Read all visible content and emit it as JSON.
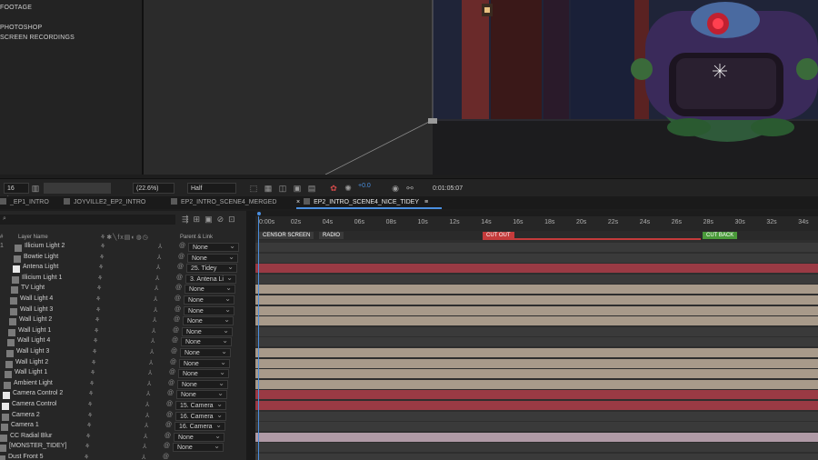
{
  "project": {
    "items": [
      "FOOTAGE",
      "PHOTOSHOP",
      "SCREEN RECORDINGS"
    ]
  },
  "viewer": {
    "bpc": "16 bpc",
    "zoom": "(22.6%)",
    "resolution": "Half",
    "exposure": "+0.0",
    "timecode": "0:01:05:07"
  },
  "tabs": [
    {
      "label": "_EP1_INTRO",
      "color": "#5a8a3a"
    },
    {
      "label": "JOYVILLE2_EP2_INTRO",
      "color": "#555555"
    },
    {
      "label": "EP2_INTRO_SCENE4_MERGED",
      "color": "#555555"
    },
    {
      "label": "EP2_INTRO_SCENE4_NICE_TIDEY",
      "color": "#555555",
      "active": true
    }
  ],
  "layer_panel": {
    "search_placeholder": "",
    "col_layer_name": "Layer Name",
    "col_parent": "Parent & Link",
    "col_hash": "#"
  },
  "layers": [
    {
      "num": "1",
      "name": "Illicium Light 2",
      "parent": "None",
      "color": "#7a7a7a"
    },
    {
      "num": "",
      "name": "Bowtie Light",
      "parent": "None",
      "color": "#7a7a7a"
    },
    {
      "num": "",
      "name": "Antena Light",
      "parent": "25. Tidey",
      "color": "#e8e8e8"
    },
    {
      "num": "",
      "name": "Illicium Light 1",
      "parent": "3. Antena Li",
      "color": "#7a7a7a"
    },
    {
      "num": "",
      "name": "TV Light",
      "parent": "None",
      "color": "#7a7a7a"
    },
    {
      "num": "",
      "name": "Wall Light 4",
      "parent": "None",
      "color": "#7a7a7a"
    },
    {
      "num": "",
      "name": "Wall Light 3",
      "parent": "None",
      "color": "#7a7a7a"
    },
    {
      "num": "",
      "name": "Wall Light 2",
      "parent": "None",
      "color": "#7a7a7a"
    },
    {
      "num": "",
      "name": "Wall Light 1",
      "parent": "None",
      "color": "#7a7a7a"
    },
    {
      "num": "",
      "name": "Wall Light 4",
      "parent": "None",
      "color": "#7a7a7a"
    },
    {
      "num": "",
      "name": "Wall Light 3",
      "parent": "None",
      "color": "#7a7a7a"
    },
    {
      "num": "",
      "name": "Wall Light 2",
      "parent": "None",
      "color": "#7a7a7a"
    },
    {
      "num": "",
      "name": "Wall Light 1",
      "parent": "None",
      "color": "#7a7a7a"
    },
    {
      "num": "",
      "name": "Ambient Light",
      "parent": "None",
      "color": "#7a7a7a"
    },
    {
      "num": "",
      "name": "Camera Control 2",
      "parent": "None",
      "color": "#e8e8e8"
    },
    {
      "num": "",
      "name": "Camera Control",
      "parent": "15. Camera",
      "color": "#e8e8e8"
    },
    {
      "num": "",
      "name": "Camera 2",
      "parent": "16. Camera",
      "color": "#7a7a7a"
    },
    {
      "num": "",
      "name": "Camera 1",
      "parent": "16. Camera",
      "color": "#7a7a7a"
    },
    {
      "num": "",
      "name": "CC Radial Blur",
      "parent": "None",
      "color": "#7a7a7a"
    },
    {
      "num": "",
      "name": "[MONSTER_TIDEY]",
      "parent": "None",
      "color": "#7a7a7a"
    },
    {
      "num": "",
      "name": "Dust Front 5",
      "parent": "",
      "color": "#7a7a7a"
    }
  ],
  "timeline": {
    "ticks": [
      "0:00s",
      "02s",
      "04s",
      "06s",
      "08s",
      "10s",
      "12s",
      "14s",
      "16s",
      "18s",
      "20s",
      "22s",
      "24s",
      "26s",
      "28s",
      "30s",
      "32s",
      "34s"
    ],
    "markers": [
      {
        "label": "CENSOR SCREEN",
        "color": "#8a8a8a"
      },
      {
        "label": "RADIO",
        "color": "#8a8a8a"
      },
      {
        "label": "CUT OUT",
        "color": "#c43b3b"
      },
      {
        "label": "CUT BACK",
        "color": "#4a9a3a"
      }
    ],
    "bar_colors": [
      "#3a3a3a",
      "#3a3a3a",
      "#9a3a44",
      "#3a3a3a",
      "#a89a8a",
      "#a89a8a",
      "#a89a8a",
      "#a89a8a",
      "#3a3a3a",
      "#3a3a3a",
      "#a89a8a",
      "#a89a8a",
      "#a89a8a",
      "#a89a8a",
      "#9a3a44",
      "#9a3a44",
      "#3a3a3a",
      "#3a3a3a",
      "#b09aa6",
      "#3a3a3a",
      "#3a3a3a"
    ]
  },
  "colors": {
    "accent_blue": "#4a8fe0",
    "panel": "#262626"
  }
}
